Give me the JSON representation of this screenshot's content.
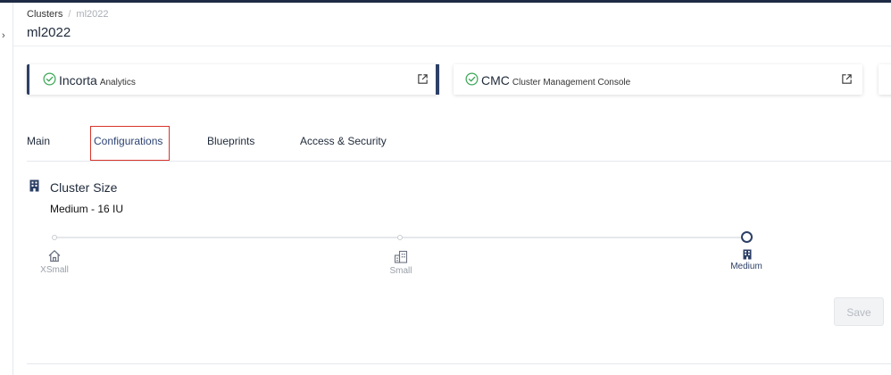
{
  "breadcrumb": {
    "root": "Clusters",
    "separator": "/",
    "current": "ml2022"
  },
  "page": {
    "title": "ml2022"
  },
  "nav": {
    "toggle_glyph": "›"
  },
  "cards": [
    {
      "title": "Incorta",
      "subtitle": "Analytics",
      "status_icon": "check-circle-icon",
      "action_icon": "external-link-icon"
    },
    {
      "title": "CMC",
      "subtitle": "Cluster Management Console",
      "status_icon": "check-circle-icon",
      "action_icon": "external-link-icon"
    }
  ],
  "tabs": [
    {
      "label": "Main",
      "active": false
    },
    {
      "label": "Configurations",
      "active": true
    },
    {
      "label": "Blueprints",
      "active": false
    },
    {
      "label": "Access & Security",
      "active": false
    }
  ],
  "cluster_size": {
    "section_title": "Cluster Size",
    "section_icon": "building-icon",
    "current_value": "Medium - 16 IU",
    "options": [
      {
        "label": "XSmall",
        "icon": "house-icon",
        "selected": false
      },
      {
        "label": "Small",
        "icon": "buildings-icon",
        "selected": false
      },
      {
        "label": "Medium",
        "icon": "building-icon",
        "selected": true
      }
    ]
  },
  "actions": {
    "save_label": "Save"
  },
  "colors": {
    "accent": "#2c3f66",
    "success": "#3aa655",
    "highlight": "#d9342b",
    "topbar": "#1e2a44"
  }
}
